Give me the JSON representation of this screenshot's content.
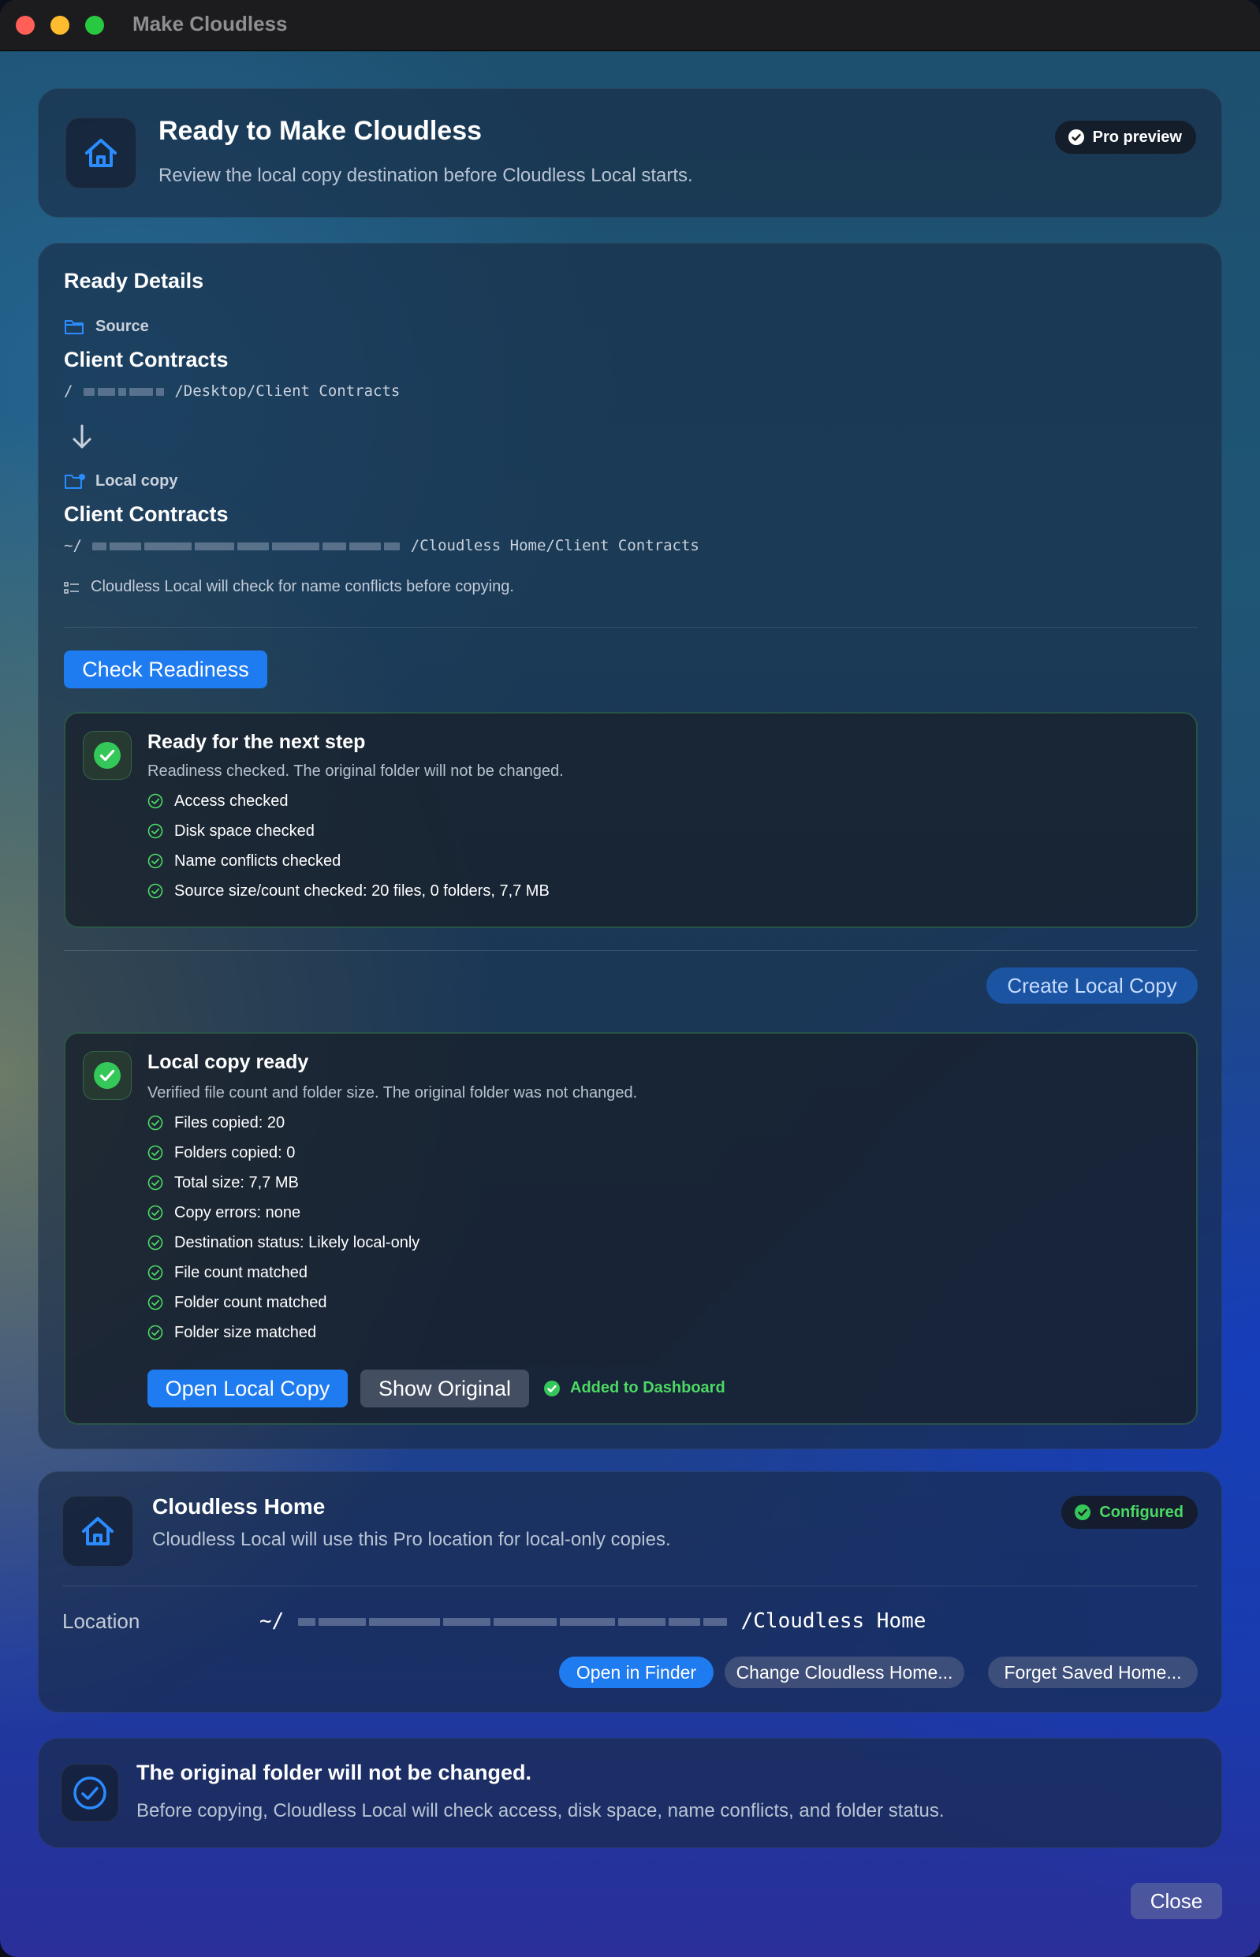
{
  "window": {
    "title": "Make Cloudless"
  },
  "header": {
    "title": "Ready to Make Cloudless",
    "subtitle": "Review the local copy destination before Cloudless Local starts.",
    "badge": "Pro preview"
  },
  "details": {
    "section_title": "Ready Details",
    "source_label": "Source",
    "source_name": "Client Contracts",
    "source_path_prefix": "/",
    "source_path_suffix": "/Desktop/Client Contracts",
    "local_label": "Local copy",
    "local_name": "Client Contracts",
    "local_path_prefix": "~/",
    "local_path_suffix": "/Cloudless Home/Client Contracts",
    "conflict_note": "Cloudless Local will check for name conflicts before copying.",
    "check_button": "Check Readiness"
  },
  "readiness": {
    "title": "Ready for the next step",
    "subtitle": "Readiness checked. The original folder will not be changed.",
    "items": [
      "Access checked",
      "Disk space checked",
      "Name conflicts checked",
      "Source size/count checked: 20 files, 0 folders, 7,7 MB"
    ]
  },
  "create_button": "Create Local Copy",
  "copy_result": {
    "title": "Local copy ready",
    "subtitle": "Verified file count and folder size. The original folder was not changed.",
    "items": [
      "Files copied: 20",
      "Folders copied: 0",
      "Total size: 7,7 MB",
      "Copy errors: none",
      "Destination status: Likely local-only",
      "File count matched",
      "Folder count matched",
      "Folder size matched"
    ],
    "open_button": "Open Local Copy",
    "show_button": "Show Original",
    "added_status": "Added to Dashboard"
  },
  "home": {
    "title": "Cloudless Home",
    "subtitle": "Cloudless Local will use this Pro location for local-only copies.",
    "badge": "Configured",
    "location_label": "Location",
    "location_prefix": "~/",
    "location_suffix": "/Cloudless Home",
    "finder_button": "Open in Finder",
    "change_button": "Change Cloudless Home...",
    "forget_button": "Forget Saved Home..."
  },
  "notice": {
    "title": "The original folder will not be changed.",
    "subtitle": "Before copying, Cloudless Local will check access, disk space, name conflicts, and folder status."
  },
  "close_button": "Close",
  "colors": {
    "accent": "#1e7bf0",
    "success": "#4cd964"
  }
}
